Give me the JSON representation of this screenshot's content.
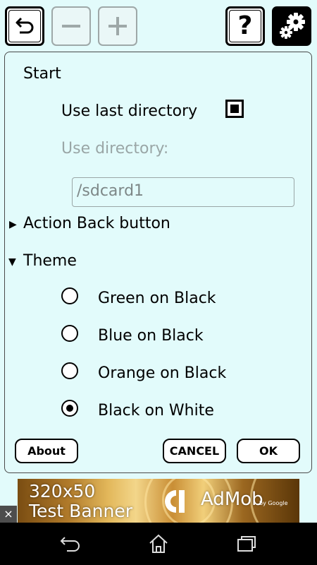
{
  "toolbar": {
    "undo_icon": "undo-icon",
    "minus_icon": "minus-icon",
    "plus_icon": "plus-icon",
    "help_label": "?",
    "settings_icon": "gear-icon"
  },
  "settings": {
    "start_header": "Start",
    "use_last_directory_label": "Use last directory",
    "use_last_directory_checked": true,
    "use_directory_label": "Use directory:",
    "directory_value": "/sdcard1",
    "action_back_label": "Action Back button",
    "action_back_expanded": false,
    "theme_label": "Theme",
    "theme_expanded": true,
    "theme_options": [
      {
        "label": "Green on Black",
        "selected": false
      },
      {
        "label": "Blue on Black",
        "selected": false
      },
      {
        "label": "Orange on Black",
        "selected": false
      },
      {
        "label": "Black on White",
        "selected": true
      }
    ]
  },
  "buttons": {
    "about": "About",
    "cancel": "CANCEL",
    "ok": "OK"
  },
  "ad": {
    "line1": "320x50",
    "line2": "Test Banner",
    "brand": "AdMob",
    "brand_sub": "by Google",
    "close": "×"
  },
  "navbar": {
    "back_icon": "back-icon",
    "home_icon": "home-icon",
    "recents_icon": "recents-icon"
  }
}
